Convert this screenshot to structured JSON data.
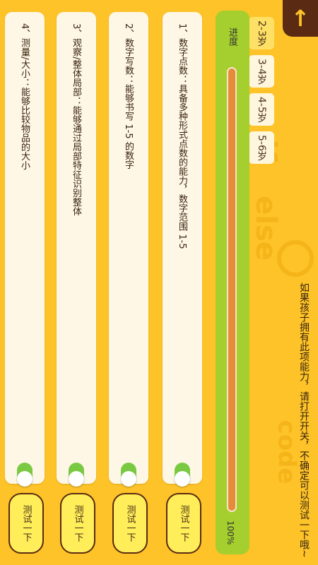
{
  "header": {
    "back_icon": "arrow-up-icon"
  },
  "hint": "如果孩子拥有此项能力，请打开开关，不确定可以测试一下哦~",
  "age_tabs": [
    "2-3岁",
    "3-4岁",
    "4-5岁",
    "5-6岁"
  ],
  "active_tab": "2-3岁",
  "progress": {
    "label": "进度",
    "end_label": "100%",
    "value": 1.0
  },
  "skills": [
    {
      "text": "1、数字点数：具备多种形式点数的能力，数字范围 1-5",
      "toggled": true,
      "test_label": "测试一下"
    },
    {
      "text": "2、数字写数：能够书写 1-5 的数字",
      "toggled": true,
      "test_label": "测试一下"
    },
    {
      "text": "3、观察/整体局部：能够通过局部特征识别整体",
      "toggled": true,
      "test_label": "测试一下"
    },
    {
      "text": "4、测量/大小：能够比较物品的大小",
      "toggled": true,
      "test_label": "测试一下"
    }
  ],
  "colors": {
    "background": "#FDC328",
    "progress_panel": "#A4CF2E",
    "progress_fill": "#E68A3C",
    "toggle_on": "#7AC943",
    "back_button": "#5A2A12"
  }
}
